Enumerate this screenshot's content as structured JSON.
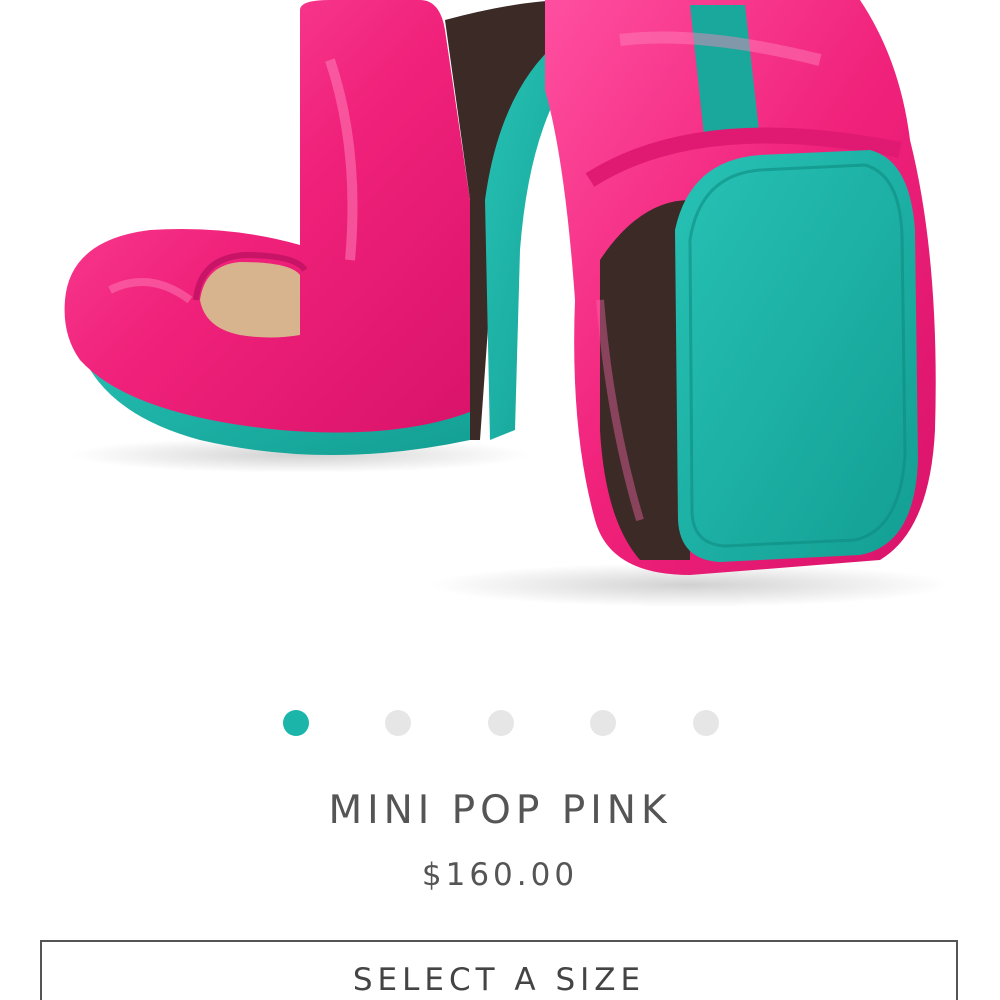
{
  "product": {
    "name": "MINI POP PINK",
    "price": "$160.00",
    "select_size_label": "SELECT A SIZE",
    "colors": {
      "accent": "#1bb5aa",
      "shoe_pink": "#f0217a",
      "sole_teal": "#19b0a4"
    }
  },
  "carousel": {
    "slide_count": 5,
    "active_index": 0
  }
}
